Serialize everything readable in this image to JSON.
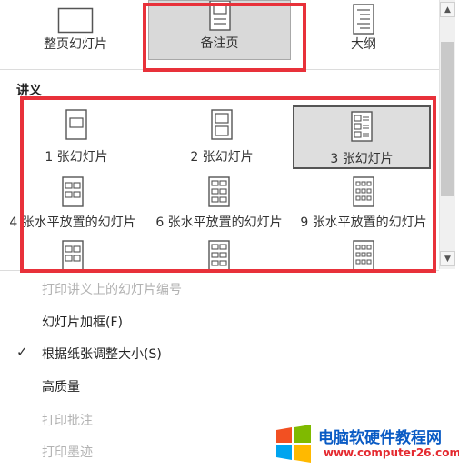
{
  "top_layouts": [
    {
      "label": "整页幻灯片"
    },
    {
      "label": "备注页"
    },
    {
      "label": "大纲"
    }
  ],
  "handouts": {
    "title": "讲义",
    "items": [
      {
        "label": "1 张幻灯片"
      },
      {
        "label": "2 张幻灯片"
      },
      {
        "label": "3 张幻灯片"
      },
      {
        "label": "4 张水平放置的幻灯片"
      },
      {
        "label": "6 张水平放置的幻灯片"
      },
      {
        "label": "9 张水平放置的幻灯片"
      }
    ]
  },
  "options": {
    "print_slide_numbers": "打印讲义上的幻灯片编号",
    "frame_slides": "幻灯片加框(F)",
    "scale_to_fit": "根据纸张调整大小(S)",
    "high_quality": "高质量",
    "print_comments": "打印批注",
    "print_ink": "打印墨迹"
  },
  "check_mark": "✓",
  "watermark": {
    "title": "电脑软硬件教程网",
    "url": "www.computer26.com"
  },
  "colors": {
    "highlight_box": "#e8313a",
    "selected_bg": "#d9d9d9",
    "disabled_text": "#b2b2b2",
    "watermark_blue": "#0a5bc4"
  }
}
